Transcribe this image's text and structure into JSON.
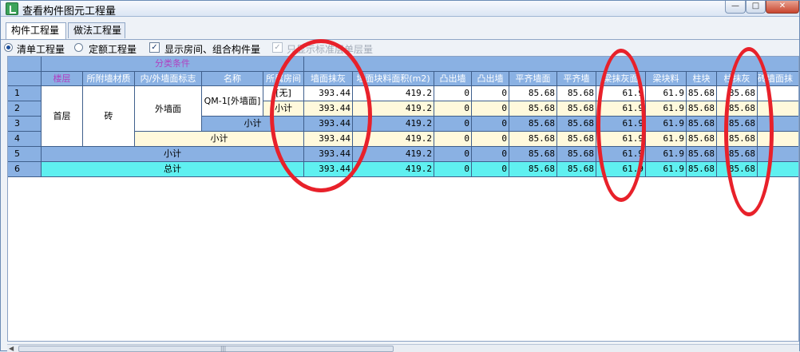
{
  "window": {
    "title": "查看构件图元工程量",
    "min_glyph": "—",
    "max_glyph": "□",
    "close_glyph": "✕"
  },
  "tabs": [
    {
      "label": "构件工程量",
      "active": true
    },
    {
      "label": "做法工程量",
      "active": false
    }
  ],
  "options": {
    "radio_bill": "清单工程量",
    "radio_quota": "定额工程量",
    "show_rooms": "显示房间、组合构件量",
    "standard_floor_only": "只显示标准层单层量"
  },
  "grid": {
    "group_header": "分类条件",
    "headers": [
      "楼层",
      "所附墙材质",
      "内/外墙面标志",
      "名称",
      "所属房间",
      "墙面抹灰",
      "墙面块料面积(m2)",
      "凸出墙",
      "凸出墙",
      "平齐墙面",
      "平齐墙",
      "梁抹灰面",
      "梁块料",
      "柱块",
      "柱抹灰",
      "砖墙面抹"
    ],
    "row_numbers": [
      "1",
      "2",
      "3",
      "4",
      "5",
      "6"
    ],
    "floor": "首层",
    "material": "砖",
    "face": "外墙面",
    "name": "QM-1[外墙面]",
    "room_none": "[无]",
    "subtotal": "小计",
    "total": "总计",
    "row_values": [
      "393.44",
      "419.2",
      "0",
      "0",
      "85.68",
      "85.68",
      "61.9",
      "61.9",
      "85.68",
      "85.68"
    ]
  },
  "annotation_color": "#e8212a"
}
